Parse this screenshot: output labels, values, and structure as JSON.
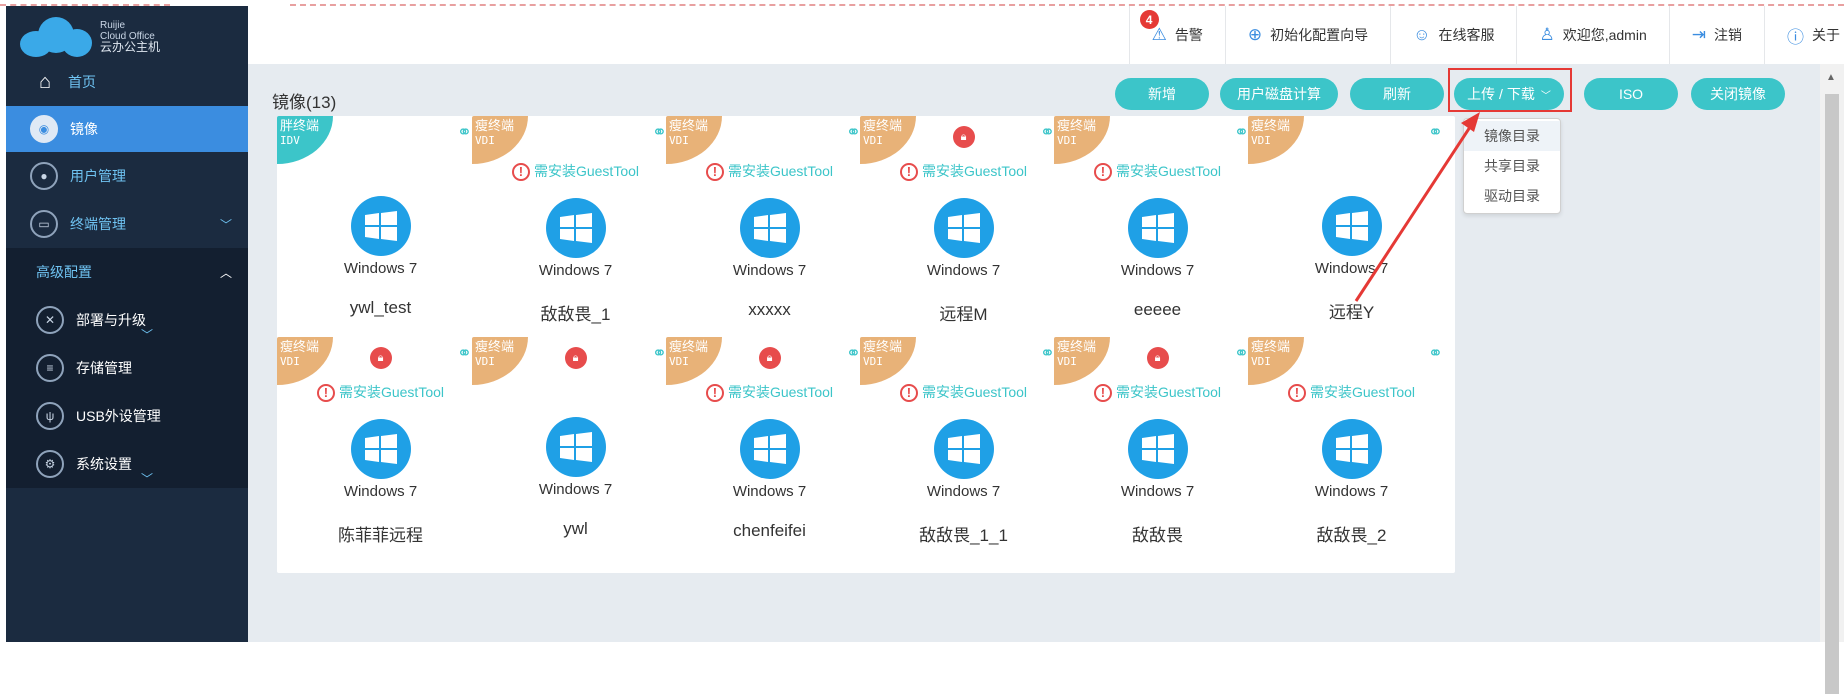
{
  "brand": {
    "line1": "Ruijie",
    "line2": "Cloud Office",
    "line3": "云办公主机"
  },
  "sidebar": {
    "items": [
      {
        "label": "首页"
      },
      {
        "label": "镜像"
      },
      {
        "label": "用户管理"
      },
      {
        "label": "终端管理"
      }
    ],
    "section": {
      "label": "高级配置"
    },
    "sub_items": [
      {
        "label": "部署与升级"
      },
      {
        "label": "存储管理"
      },
      {
        "label": "USB外设管理"
      },
      {
        "label": "系统设置"
      }
    ]
  },
  "header": {
    "alert_count": "4",
    "items": [
      {
        "label": "告警",
        "icon": "warning-icon"
      },
      {
        "label": "初始化配置向导",
        "icon": "globe-icon"
      },
      {
        "label": "在线客服",
        "icon": "support-icon"
      },
      {
        "label": "欢迎您,admin",
        "icon": "user-icon"
      },
      {
        "label": "注销",
        "icon": "logout-icon"
      },
      {
        "label": "关于",
        "icon": "info-icon"
      }
    ]
  },
  "main": {
    "title": "镜像(13)",
    "toolbar": {
      "add": "新增",
      "disk_calc": "用户磁盘计算",
      "refresh": "刷新",
      "upload_download": "上传 / 下载",
      "iso": "ISO",
      "close_image": "关闭镜像"
    },
    "dropdown": [
      "镜像目录",
      "共享目录",
      "驱动目录"
    ],
    "warning_text": "需安装GuestTool",
    "os_label": "Windows 7",
    "cards": [
      {
        "type": "胖终端",
        "proto": "IDV",
        "name": "ywl_test",
        "lock": false,
        "warn": false
      },
      {
        "type": "瘦终端",
        "proto": "VDI",
        "name": "敌敌畏_1",
        "lock": false,
        "warn": true
      },
      {
        "type": "瘦终端",
        "proto": "VDI",
        "name": "xxxxx",
        "lock": false,
        "warn": true
      },
      {
        "type": "瘦终端",
        "proto": "VDI",
        "name": "远程M",
        "lock": true,
        "warn": true
      },
      {
        "type": "瘦终端",
        "proto": "VDI",
        "name": "eeeee",
        "lock": false,
        "warn": true
      },
      {
        "type": "瘦终端",
        "proto": "VDI",
        "name": "远程Y",
        "lock": false,
        "warn": false
      },
      {
        "type": "瘦终端",
        "proto": "VDI",
        "name": "陈菲菲远程",
        "lock": true,
        "warn": true
      },
      {
        "type": "瘦终端",
        "proto": "VDI",
        "name": "ywl",
        "lock": true,
        "warn": false
      },
      {
        "type": "瘦终端",
        "proto": "VDI",
        "name": "chenfeifei",
        "lock": true,
        "warn": true
      },
      {
        "type": "瘦终端",
        "proto": "VDI",
        "name": "敌敌畏_1_1",
        "lock": false,
        "warn": true
      },
      {
        "type": "瘦终端",
        "proto": "VDI",
        "name": "敌敌畏",
        "lock": true,
        "warn": true
      },
      {
        "type": "瘦终端",
        "proto": "VDI",
        "name": "敌敌畏_2",
        "lock": false,
        "warn": true
      }
    ]
  },
  "colors": {
    "accent": "#3cc5c9",
    "sidebar": "#1b2b40",
    "active": "#3b8de0",
    "thin": "#e8b278",
    "alert": "#e53935"
  }
}
